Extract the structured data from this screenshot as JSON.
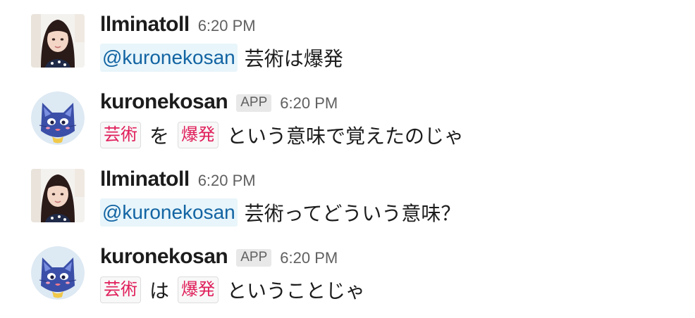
{
  "messages": [
    {
      "sender": "llminatoll",
      "time": "6:20 PM",
      "avatar": "user-photo-avatar",
      "mention": "@kuronekosan",
      "text": "芸術は爆発"
    },
    {
      "sender": "kuronekosan",
      "badge": "APP",
      "time": "6:20 PM",
      "avatar": "cat-mascot-avatar",
      "code_1": "芸術",
      "text_1": "を",
      "code_2": "爆発",
      "text_2": "という意味で覚えたのじゃ"
    },
    {
      "sender": "llminatoll",
      "time": "6:20 PM",
      "avatar": "user-photo-avatar",
      "mention": "@kuronekosan",
      "text": "芸術ってどういう意味？"
    },
    {
      "sender": "kuronekosan",
      "badge": "APP",
      "time": "6:20 PM",
      "avatar": "cat-mascot-avatar",
      "code_1": "芸術",
      "text_1": "は",
      "code_2": "爆発",
      "text_2": "ということじゃ"
    }
  ],
  "colors": {
    "mention_bg": "#e8f5fa",
    "mention_text": "#1264a3",
    "code_text": "#e01e5a",
    "code_bg": "#f8f8f8",
    "timestamp": "#616061",
    "badge_bg": "#e8e8e8"
  }
}
